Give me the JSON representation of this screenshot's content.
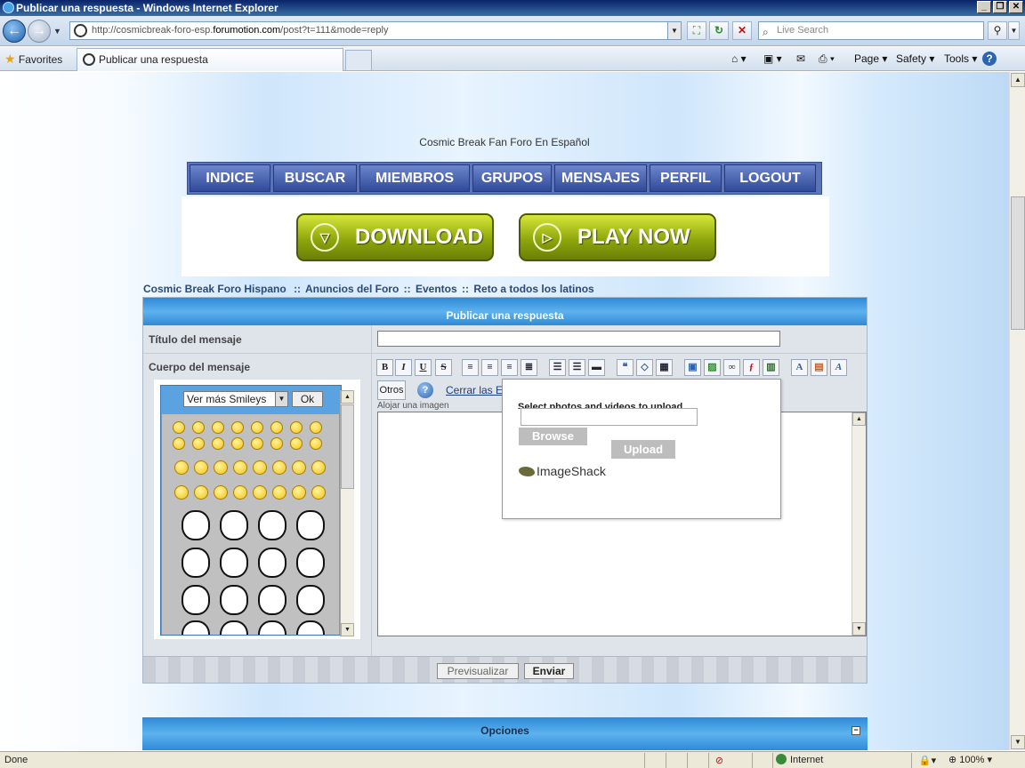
{
  "window": {
    "title": "Publicar una respuesta - Windows Internet Explorer",
    "min_label": "_",
    "max_label": "❐",
    "close_label": "✕"
  },
  "address": {
    "url_prefix": "http://cosmicbreak-foro-esp.",
    "url_domain": "forumotion.com",
    "url_suffix": "/post?t=111&mode=reply"
  },
  "search": {
    "placeholder": "Live Search"
  },
  "favorites": {
    "label": "Favorites"
  },
  "tabs": [
    {
      "label": "Publicar una respuesta"
    }
  ],
  "commands": {
    "page": "Page ▾",
    "safety": "Safety ▾",
    "tools": "Tools ▾",
    "help": "?"
  },
  "site": {
    "title": "Cosmic Break Fan Foro En Español",
    "menu": [
      "INDICE",
      "BUSCAR",
      "MIEMBROS",
      "GRUPOS",
      "MENSAJES",
      "PERFIL",
      "LOGOUT"
    ],
    "banner": {
      "download": "DOWNLOAD",
      "play_now": "PLAY NOW"
    }
  },
  "breadcrumb": {
    "items": [
      "Cosmic Break Foro Hispano",
      "Anuncios del Foro",
      "Eventos",
      "Reto a todos los latinos"
    ],
    "sep": "::"
  },
  "form": {
    "header": "Publicar una respuesta",
    "title_label": "Título del mensaje",
    "title_value": "",
    "body_label": "Cuerpo del mensaje",
    "smileys": {
      "select_value": "Ver más Smileys",
      "ok_label": "Ok"
    },
    "otros_label": "Otros",
    "close_link": "Cerrar las E",
    "alojar_label": "Alojar una imagen",
    "upload": {
      "title": "Select photos and videos to upload",
      "browse_label": "Browse",
      "upload_label": "Upload",
      "brand": "ImageShack"
    },
    "preview_label": "Previsualizar",
    "send_label": "Enviar"
  },
  "options": {
    "title": "Opciones",
    "toggle": "−"
  },
  "status": {
    "text": "Done",
    "zone": "Internet",
    "zoom": "100%"
  },
  "colors": {
    "menu_bg": "#5b73b9",
    "header_blue": "#2f8ad6",
    "banner_green": "#8fa70c"
  }
}
